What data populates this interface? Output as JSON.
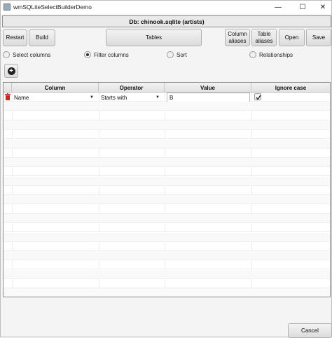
{
  "window": {
    "title": "wmSQLiteSelectBuilderDemo",
    "controls": {
      "minimize": "—",
      "maximize": "☐",
      "close": "✕"
    }
  },
  "db_header": "Db: chinook.sqlite (artists)",
  "toolbar": {
    "restart": "Restart",
    "build": "Build",
    "tables": "Tables",
    "column_aliases": "Column aliases",
    "table_aliases": "Table aliases",
    "open": "Open",
    "save": "Save"
  },
  "modes": {
    "select_columns": "Select columns",
    "filter_columns": "Filter columns",
    "sort": "Sort",
    "relationships": "Relationships",
    "selected": "Filter columns"
  },
  "add_button": "+",
  "table": {
    "headers": [
      "Column",
      "Operator",
      "Value",
      "Ignore case"
    ],
    "rows": [
      {
        "column": "Name",
        "operator": "Starts with",
        "value": "B",
        "ignore_case": true
      }
    ]
  },
  "footer": {
    "cancel": "Cancel"
  },
  "colors": {
    "delete_icon": "#c62828",
    "background": "#f4f4f4"
  }
}
